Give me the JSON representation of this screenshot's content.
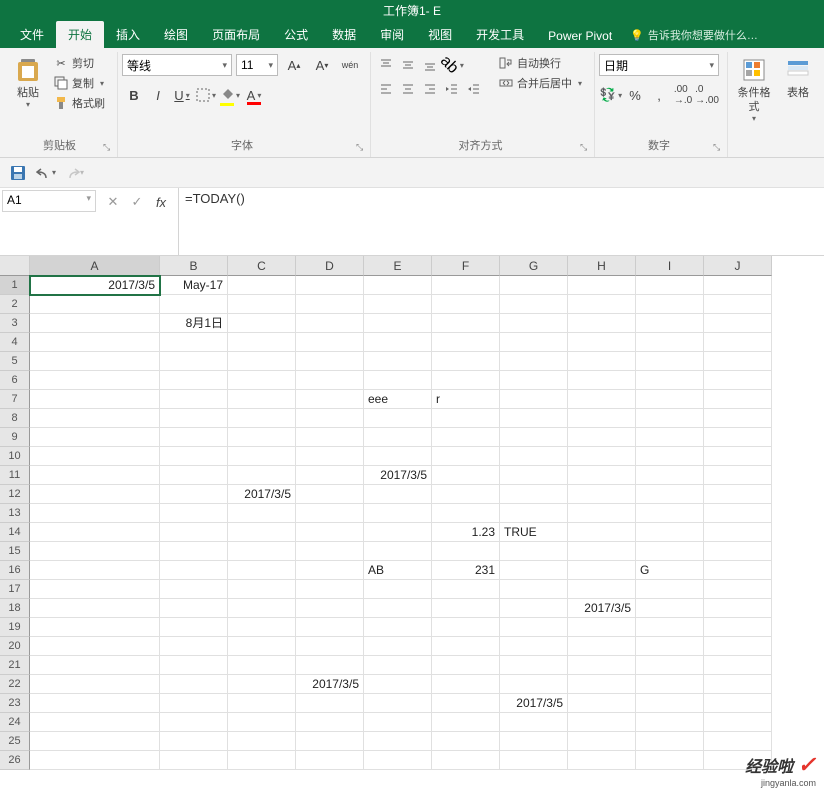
{
  "title": {
    "workbook": "工作簿1",
    "suffix": " - E"
  },
  "tabs": {
    "file": "文件",
    "home": "开始",
    "insert": "插入",
    "draw": "绘图",
    "layout": "页面布局",
    "formulas": "公式",
    "data": "数据",
    "review": "审阅",
    "view": "视图",
    "developer": "开发工具",
    "pivot": "Power Pivot",
    "tell_me": "告诉我你想要做什么…"
  },
  "clipboard": {
    "paste": "粘贴",
    "cut": "剪切",
    "copy": "复制",
    "format_painter": "格式刷",
    "group": "剪贴板"
  },
  "font": {
    "name": "等线",
    "size": "11",
    "group": "字体",
    "bold": "B",
    "italic": "I",
    "underline": "U"
  },
  "align": {
    "wrap": "自动换行",
    "merge": "合并后居中",
    "group": "对齐方式"
  },
  "number": {
    "format": "日期",
    "group": "数字"
  },
  "styles": {
    "cond_fmt": "条件格式",
    "cell_styles": "表格"
  },
  "name_box": "A1",
  "formula": "=TODAY()",
  "columns": [
    "A",
    "B",
    "C",
    "D",
    "E",
    "F",
    "G",
    "H",
    "I",
    "J"
  ],
  "cells": {
    "A1": "2017/3/5",
    "B1": "May-17",
    "B3": "8月1日",
    "E7": "eee",
    "F7": "r",
    "E11": "2017/3/5",
    "C12": "2017/3/5",
    "F14": "1.23",
    "G14": "TRUE",
    "E16": "AB",
    "F16": "231",
    "I16": "G",
    "H18": "2017/3/5",
    "D22": "2017/3/5",
    "G23": "2017/3/5"
  },
  "selected_cell": "A1",
  "watermark": {
    "text": "经验啦",
    "url": "jingyanla.com"
  }
}
